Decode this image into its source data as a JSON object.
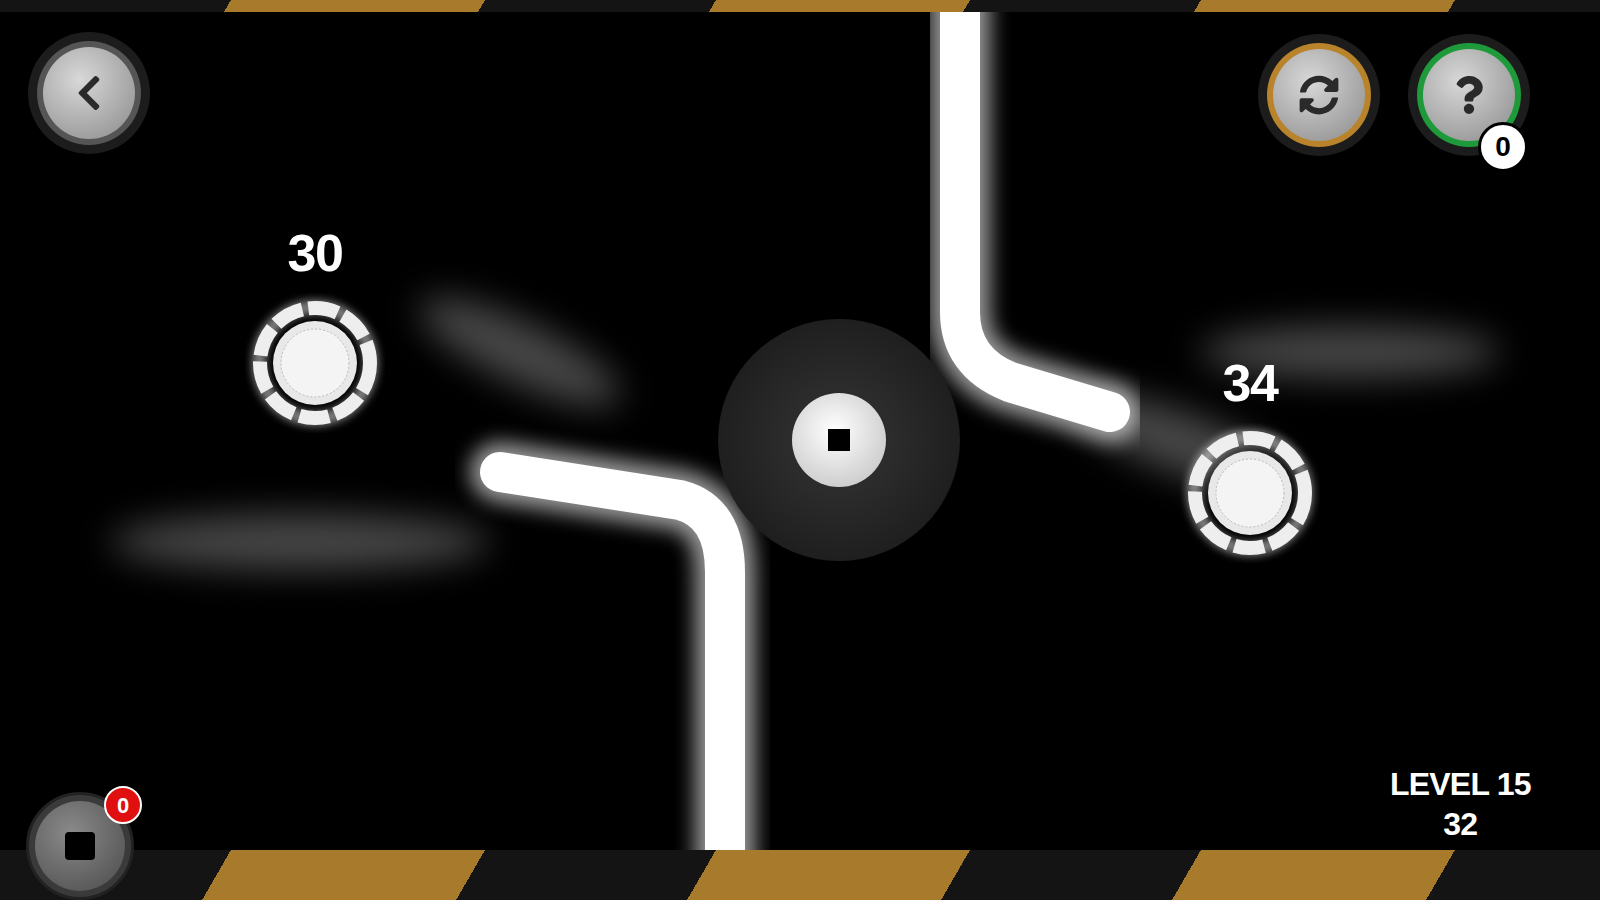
{
  "targets": [
    {
      "value": "30",
      "side": "left"
    },
    {
      "value": "34",
      "side": "right"
    }
  ],
  "hint_button": {
    "badge": "0"
  },
  "bomb_button": {
    "badge": "0"
  },
  "level": {
    "label": "LEVEL 15",
    "moves": "32"
  }
}
